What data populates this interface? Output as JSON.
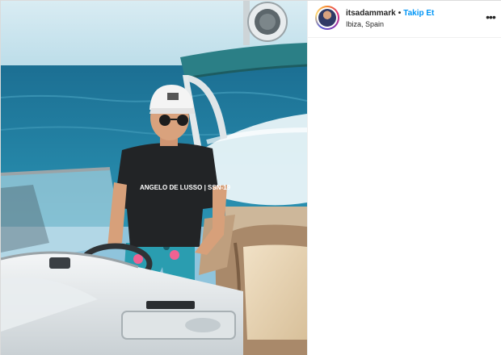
{
  "post": {
    "username": "itsadammark",
    "separator": "•",
    "follow_label": "Takip Et",
    "location": "Ibiza, Spain",
    "more_icon": "more-horizontal-icon",
    "shirt_text": "ANGELO DE LUSSO | SSN-19"
  },
  "colors": {
    "follow": "#0095f6",
    "sea": "#1f7a9c",
    "canopy": "#2b7f86"
  }
}
